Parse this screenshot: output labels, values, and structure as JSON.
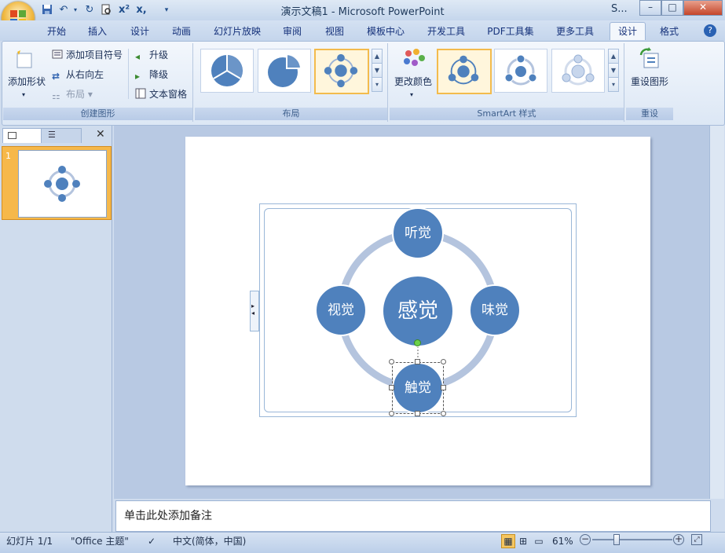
{
  "window": {
    "title": "演示文稿1 - Microsoft PowerPoint",
    "secondary_title": "S...",
    "minimize": "–",
    "restore": "□",
    "close": "✕"
  },
  "quick_access": [
    "save-icon",
    "undo-icon",
    "redo-icon",
    "print-preview-icon",
    "cut-icon",
    "format-icon",
    "customize-icon"
  ],
  "tabs": [
    {
      "label": "开始"
    },
    {
      "label": "插入"
    },
    {
      "label": "设计"
    },
    {
      "label": "动画"
    },
    {
      "label": "幻灯片放映"
    },
    {
      "label": "审阅"
    },
    {
      "label": "视图"
    },
    {
      "label": "模板中心"
    },
    {
      "label": "开发工具"
    },
    {
      "label": "PDF工具集"
    },
    {
      "label": "更多工具"
    },
    {
      "label": "设计",
      "active": true
    },
    {
      "label": "格式"
    }
  ],
  "ribbon": {
    "create_group": {
      "label": "创建图形",
      "add_shape": "添加形状",
      "add_bullet": "添加项目符号",
      "right_to_left": "从右向左",
      "layout": "布局",
      "promote": "升级",
      "demote": "降级",
      "text_pane": "文本窗格"
    },
    "layout_group": {
      "label": "布局"
    },
    "style_group": {
      "label": "SmartArt 样式",
      "change_colors": "更改颜色"
    },
    "reset_group": {
      "label": "重设",
      "reset_graphic": "重设图形"
    }
  },
  "slide_panel": {
    "slide_number": "1"
  },
  "smartart": {
    "center": "感觉",
    "top": "听觉",
    "left": "视觉",
    "right": "味觉",
    "bottom": "触觉",
    "node_color": "#4f81bd",
    "ring_color": "#b4c4de"
  },
  "notes": {
    "placeholder": "单击此处添加备注"
  },
  "statusbar": {
    "slide_info": "幻灯片 1/1",
    "theme": "\"Office 主题\"",
    "language": "中文(简体，中国)",
    "zoom": "61%"
  },
  "colors": {
    "accent": "#4f81bd",
    "ribbon_bg": "#dce7f5",
    "selected_gallery": "#f3bb4d"
  }
}
